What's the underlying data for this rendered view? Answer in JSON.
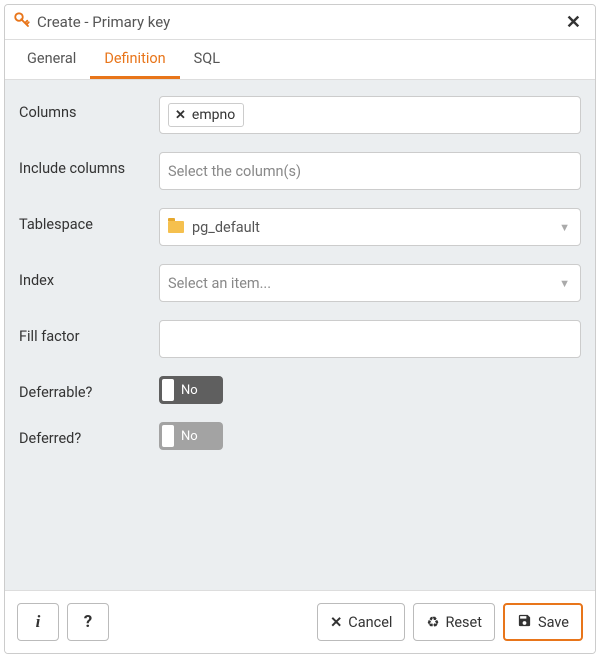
{
  "title": "Create - Primary key",
  "tabs": {
    "general": "General",
    "definition": "Definition",
    "sql": "SQL",
    "active": "definition"
  },
  "labels": {
    "columns": "Columns",
    "include_columns": "Include columns",
    "tablespace": "Tablespace",
    "index": "Index",
    "fill_factor": "Fill factor",
    "deferrable": "Deferrable?",
    "deferred": "Deferred?"
  },
  "fields": {
    "columns_tags": [
      "empno"
    ],
    "include_placeholder": "Select the column(s)",
    "tablespace_value": "pg_default",
    "index_placeholder": "Select an item...",
    "fill_factor_value": "",
    "deferrable": "No",
    "deferred": "No"
  },
  "buttons": {
    "info": "i",
    "help": "?",
    "cancel": "Cancel",
    "reset": "Reset",
    "save": "Save"
  }
}
